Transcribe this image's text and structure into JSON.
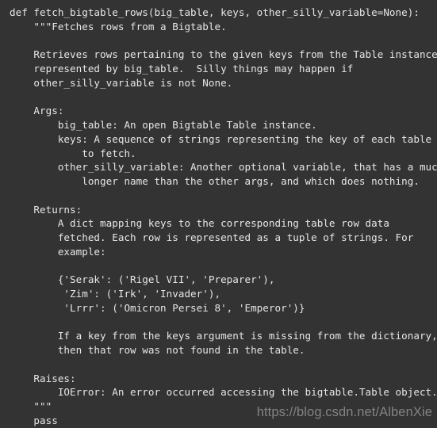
{
  "window": {
    "kind": "code-snippet-image",
    "background_color": "#333333",
    "text_color": "#e6e6e6",
    "watermark_color": "#8a8a8a"
  },
  "code": {
    "language": "python",
    "lines": [
      "def fetch_bigtable_rows(big_table, keys, other_silly_variable=None):",
      "    \"\"\"Fetches rows from a Bigtable.",
      "",
      "    Retrieves rows pertaining to the given keys from the Table instance",
      "    represented by big_table.  Silly things may happen if",
      "    other_silly_variable is not None.",
      "",
      "    Args:",
      "        big_table: An open Bigtable Table instance.",
      "        keys: A sequence of strings representing the key of each table row",
      "            to fetch.",
      "        other_silly_variable: Another optional variable, that has a much",
      "            longer name than the other args, and which does nothing.",
      "",
      "    Returns:",
      "        A dict mapping keys to the corresponding table row data",
      "        fetched. Each row is represented as a tuple of strings. For",
      "        example:",
      "",
      "        {'Serak': ('Rigel VII', 'Preparer'),",
      "         'Zim': ('Irk', 'Invader'),",
      "         'Lrrr': ('Omicron Persei 8', 'Emperor')}",
      "",
      "        If a key from the keys argument is missing from the dictionary,",
      "        then that row was not found in the table.",
      "",
      "    Raises:",
      "        IOError: An error occurred accessing the bigtable.Table object.",
      "    \"\"\"",
      "    pass"
    ]
  },
  "watermark": {
    "text": "https://blog.csdn.net/AlbenXie"
  }
}
